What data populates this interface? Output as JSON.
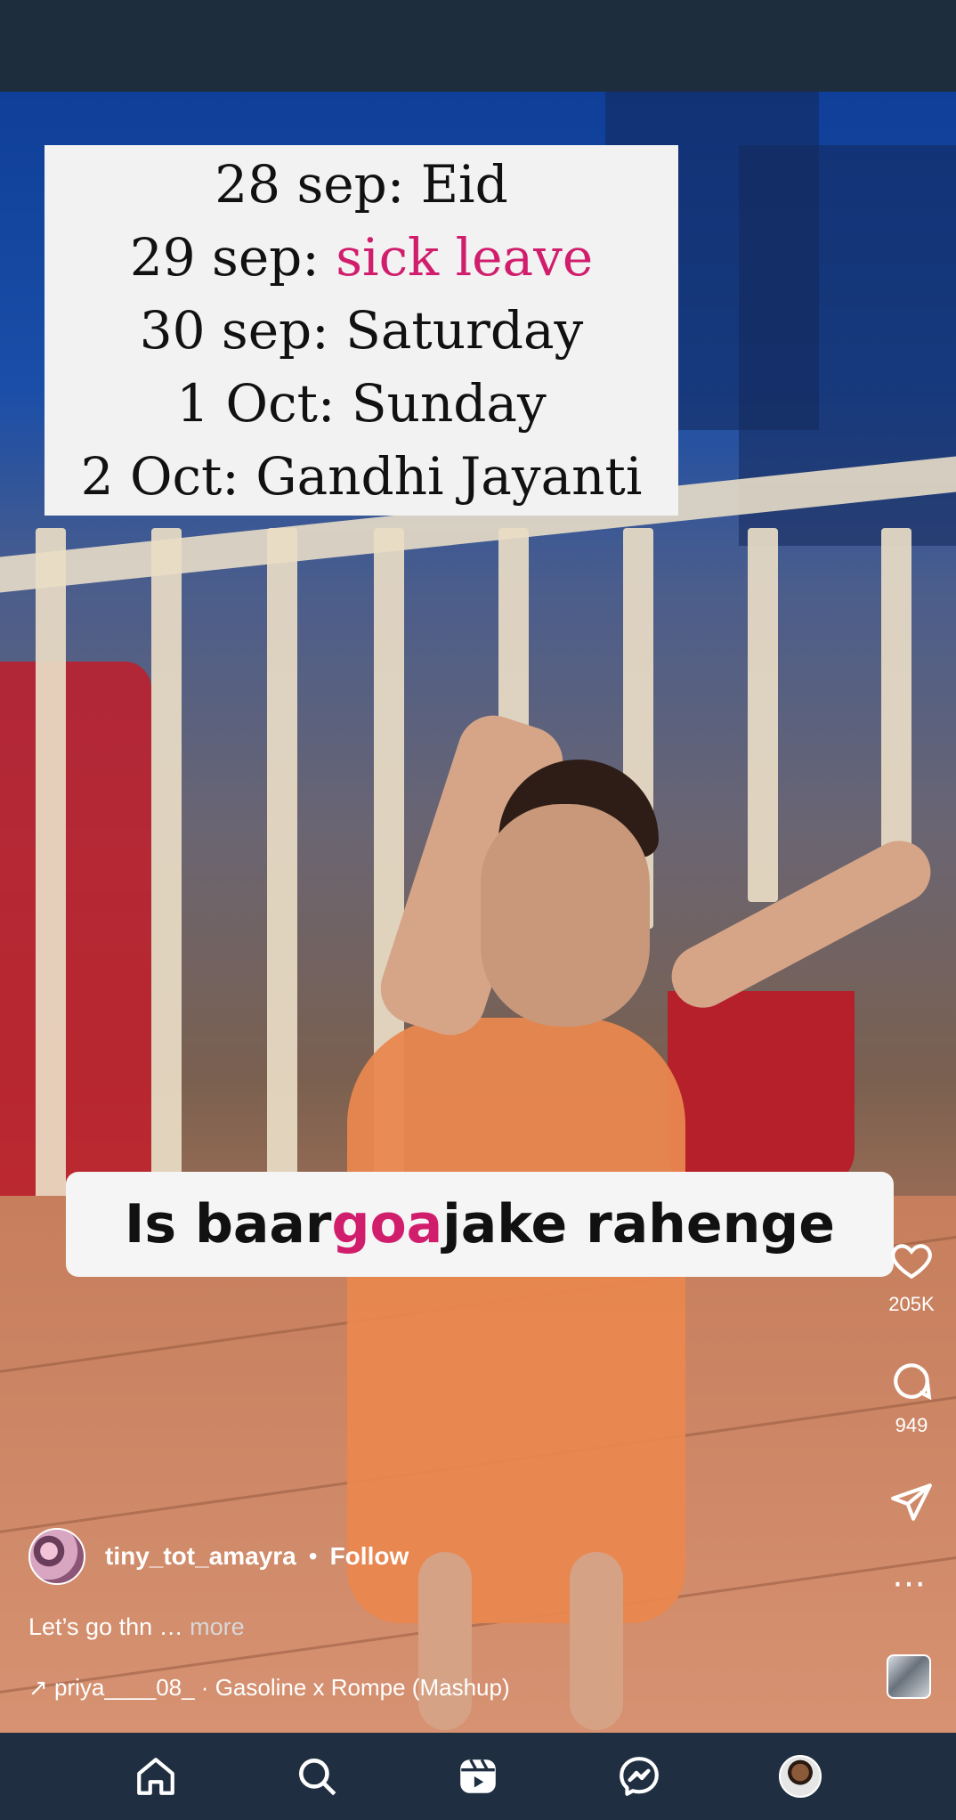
{
  "schedule": {
    "line1": "28 sep: Eid",
    "line2_prefix": "29 sep: ",
    "line2_highlight": "sick leave",
    "line3": "30 sep: Saturday",
    "line4": "1 Oct: Sunday",
    "line5": "2 Oct: Gandhi Jayanti"
  },
  "overlay_caption": {
    "part1": "Is baar ",
    "highlight": "goa",
    "part2": " jake rahenge"
  },
  "actions": {
    "likes": "205K",
    "comments": "949"
  },
  "post": {
    "username": "tiny_tot_amayra",
    "separator": "•",
    "follow_label": "Follow",
    "caption": "Let’s go thn … ",
    "caption_more": "more",
    "audio": "↗ priya____08_ · Gasoline x Rompe (Mashup)",
    "more_icon": "⋯"
  },
  "colors": {
    "highlight_pink": "#d01e6d",
    "nav_background": "#1f2f41"
  },
  "icons": [
    "heart-icon",
    "comment-icon",
    "share-icon",
    "more-icon",
    "home-icon",
    "search-icon",
    "reels-icon",
    "messenger-icon"
  ]
}
